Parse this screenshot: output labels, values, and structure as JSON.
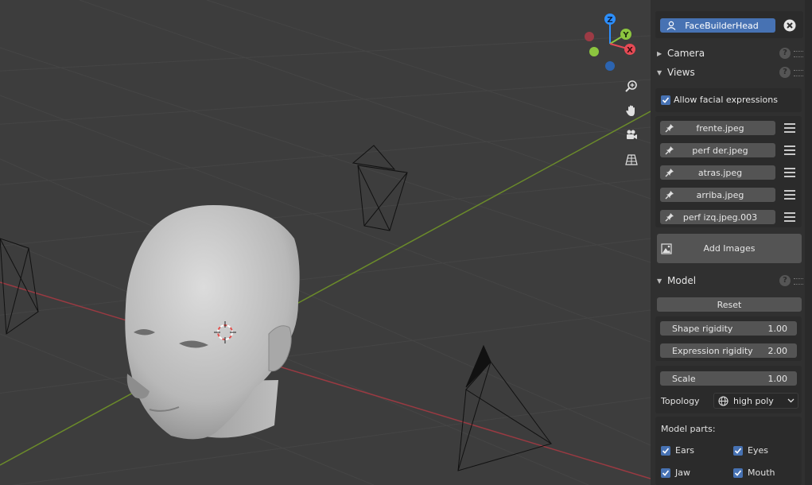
{
  "object_field": {
    "value": "FaceBuilderHead"
  },
  "sections": {
    "camera": "Camera",
    "views": "Views",
    "model": "Model"
  },
  "views": {
    "allow_expressions_label": "Allow facial expressions",
    "allow_expressions_checked": true,
    "images": [
      "frente.jpeg",
      "perf der.jpeg",
      "atras.jpeg",
      "arriba.jpeg",
      "perf izq.jpeg.003"
    ],
    "add_images_label": "Add Images"
  },
  "model": {
    "reset_label": "Reset",
    "shape_rigidity": {
      "label": "Shape rigidity",
      "value": "1.00"
    },
    "expression_rigidity": {
      "label": "Expression rigidity",
      "value": "2.00"
    },
    "scale": {
      "label": "Scale",
      "value": "1.00"
    },
    "topology": {
      "label": "Topology",
      "value": "high poly"
    },
    "model_parts_label": "Model parts:",
    "parts": [
      {
        "label": "Ears",
        "checked": true
      },
      {
        "label": "Eyes",
        "checked": true
      },
      {
        "label": "Jaw",
        "checked": true
      },
      {
        "label": "Mouth",
        "checked": true
      }
    ]
  },
  "gizmo": {
    "z": "Z",
    "y": "Y",
    "x": "X"
  },
  "help_glyph": "?",
  "colors": {
    "accent": "#4772b3",
    "x_axis": "#e74a55",
    "y_axis": "#8cc63f",
    "z_axis": "#2c8fff"
  }
}
